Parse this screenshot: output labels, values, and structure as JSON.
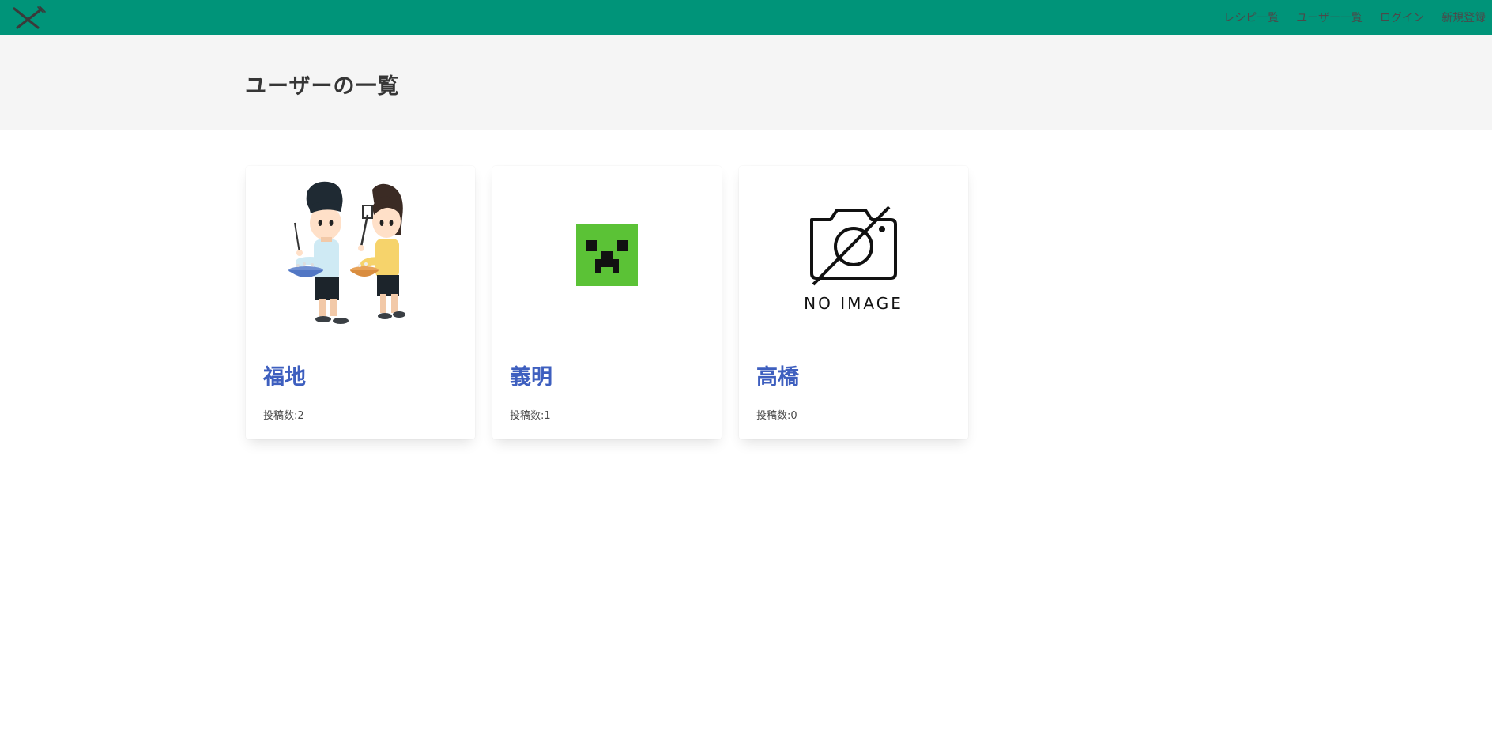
{
  "nav": {
    "links": [
      "レシピ一覧",
      "ユーザー一覧",
      "ログイン",
      "新規登録"
    ]
  },
  "page": {
    "title": "ユーザーの一覧"
  },
  "users": [
    {
      "name": "福地",
      "posts_label": "投稿数:2",
      "avatar": "cooking-couple-illustration"
    },
    {
      "name": "義明",
      "posts_label": "投稿数:1",
      "avatar": "creeper-face-icon"
    },
    {
      "name": "高橋",
      "posts_label": "投稿数:0",
      "avatar": "no-image-camera-icon",
      "avatar_text": "NO IMAGE"
    }
  ],
  "colors": {
    "navbar": "#009479",
    "hero": "#f5f5f5",
    "user_name": "#3e5fbf",
    "creeper_green": "#5bc236"
  }
}
